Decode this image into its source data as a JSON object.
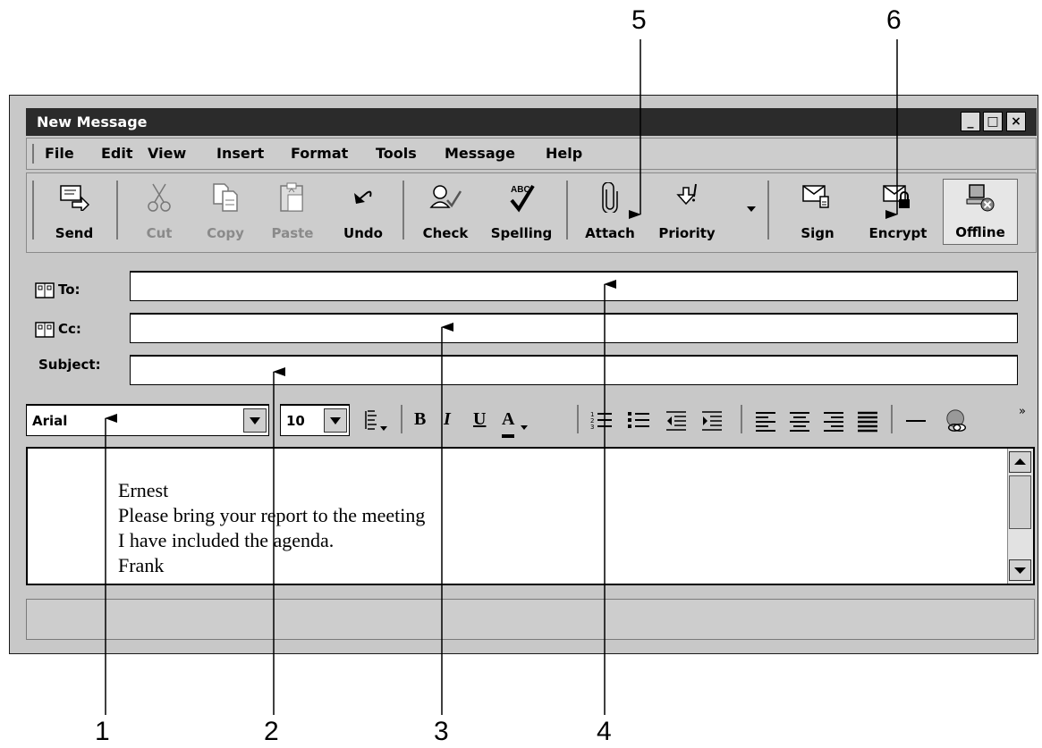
{
  "callouts": [
    "1",
    "2",
    "3",
    "4",
    "5",
    "6"
  ],
  "window": {
    "title": "New Message",
    "controls": [
      "_",
      "□",
      "×"
    ]
  },
  "menu": [
    "File",
    "Edit",
    "View",
    "Insert",
    "Format",
    "Tools",
    "Message",
    "Help"
  ],
  "toolbar": [
    {
      "label": "Send",
      "icon": "send-icon",
      "enabled": true
    },
    {
      "label": "Cut",
      "icon": "scissors-icon",
      "enabled": false
    },
    {
      "label": "Copy",
      "icon": "copy-icon",
      "enabled": false
    },
    {
      "label": "Paste",
      "icon": "paste-icon",
      "enabled": false
    },
    {
      "label": "Undo",
      "icon": "undo-icon",
      "enabled": true
    },
    {
      "label": "Check",
      "icon": "check-names-icon",
      "enabled": true
    },
    {
      "label": "Spelling",
      "icon": "spelling-icon",
      "icon_text": "ABC",
      "enabled": true
    },
    {
      "label": "Attach",
      "icon": "paperclip-icon",
      "enabled": true
    },
    {
      "label": "Priority",
      "icon": "priority-icon",
      "enabled": true
    },
    {
      "label": "Sign",
      "icon": "sign-icon",
      "enabled": true
    },
    {
      "label": "Encrypt",
      "icon": "encrypt-icon",
      "enabled": true
    },
    {
      "label": "Offline",
      "icon": "offline-icon",
      "enabled": true,
      "pressed": true
    }
  ],
  "header": {
    "to_label": "To:",
    "cc_label": "Cc:",
    "subject_label": "Subject:",
    "to_value": "",
    "cc_value": "",
    "subject_value": ""
  },
  "format": {
    "font": "Arial",
    "size": "10",
    "bold": "B",
    "italic": "I",
    "underline": "U",
    "font_color": "A",
    "more": "»"
  },
  "body": {
    "lines": [
      "Ernest",
      "Please bring your report to the meeting",
      "I have included the agenda.",
      "Frank"
    ]
  },
  "status": ""
}
